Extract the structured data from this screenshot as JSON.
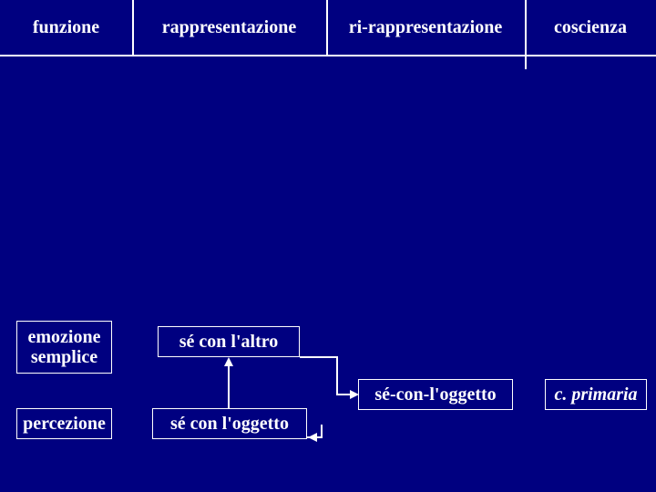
{
  "header": {
    "col1": "funzione",
    "col2": "rappresentazione",
    "col3": "ri-rappresentazione",
    "col4": "coscienza"
  },
  "boxes": {
    "emozione_semplice_line1": "emozione",
    "emozione_semplice_line2": "semplice",
    "se_con_altro": "sé con l'altro",
    "percezione": "percezione",
    "se_con_oggetto_left": "sé con l'oggetto",
    "se_con_oggetto_right": "sé-con-l'oggetto",
    "c_primaria": "c. primaria"
  }
}
